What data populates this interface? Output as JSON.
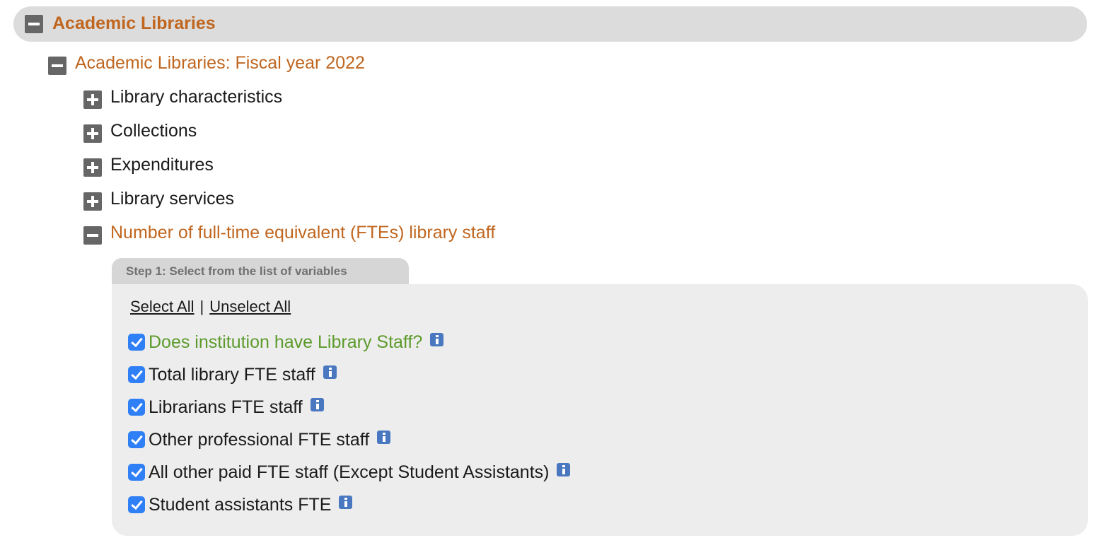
{
  "tree": {
    "root": {
      "label": "Academic Libraries",
      "icon": "minus-icon"
    },
    "year": {
      "label": "Academic Libraries: Fiscal year 2022",
      "icon": "minus-icon"
    },
    "sections": [
      {
        "label": "Library characteristics",
        "icon": "plus-icon",
        "expanded": false
      },
      {
        "label": "Collections",
        "icon": "plus-icon",
        "expanded": false
      },
      {
        "label": "Expenditures",
        "icon": "plus-icon",
        "expanded": false
      },
      {
        "label": "Library services",
        "icon": "plus-icon",
        "expanded": false
      },
      {
        "label": "Number of full-time equivalent (FTEs) library staff",
        "icon": "minus-icon",
        "expanded": true
      }
    ]
  },
  "step_panel": {
    "tab_label": "Step 1: Select from the list of variables",
    "select_all": "Select All",
    "separator": "|",
    "unselect_all": "Unselect All",
    "variables": [
      {
        "label": "Does institution have Library Staff?",
        "checked": true,
        "color": "#5d9b2c"
      },
      {
        "label": "Total library FTE staff",
        "checked": true
      },
      {
        "label": "Librarians FTE staff",
        "checked": true
      },
      {
        "label": "Other professional FTE staff",
        "checked": true
      },
      {
        "label": "All other paid FTE staff (Except Student Assistants)",
        "checked": true
      },
      {
        "label": "Student assistants FTE",
        "checked": true
      }
    ]
  },
  "colors": {
    "accent_orange": "#c0661f",
    "checkbox_blue": "#2f7ff6",
    "info_blue": "#4a78c0",
    "highlight_green": "#5d9b2c"
  }
}
